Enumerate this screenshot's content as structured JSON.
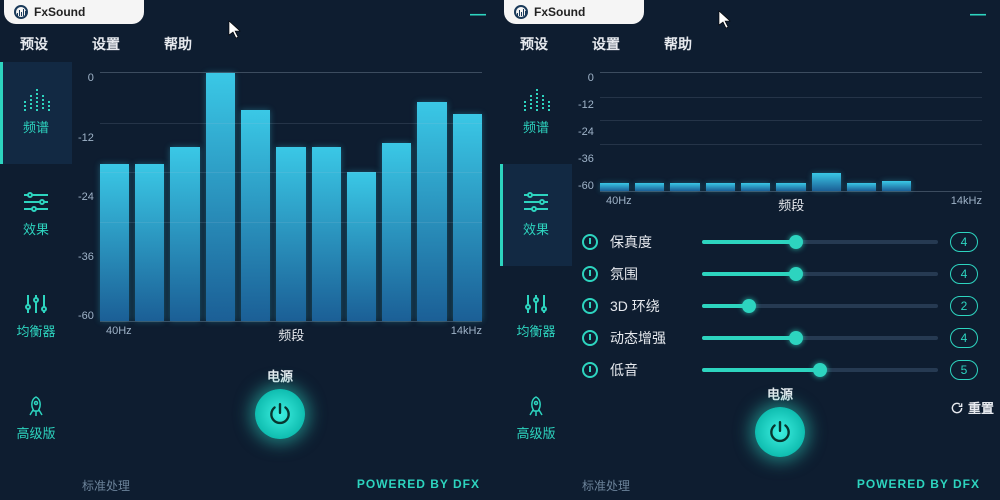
{
  "brand": "FxSound",
  "menu": {
    "presets": "预设",
    "settings": "设置",
    "help": "帮助"
  },
  "sidebar": {
    "spectrum": "频谱",
    "effects": "效果",
    "equalizer": "均衡器",
    "pro": "高级版"
  },
  "chart_data": [
    {
      "type": "bar",
      "title": "",
      "xlabel": "频段",
      "ylabel": "",
      "ylim": [
        -60,
        0
      ],
      "yticks": [
        0,
        -12,
        -24,
        -36,
        -60
      ],
      "xmin": "40Hz",
      "xmax": "14kHz",
      "values": [
        -22,
        -22,
        -18,
        0,
        -9,
        -18,
        -18,
        -24,
        -17,
        -7,
        -10
      ]
    },
    {
      "type": "bar",
      "title": "",
      "xlabel": "频段",
      "ylabel": "",
      "ylim": [
        -60,
        0
      ],
      "yticks": [
        0,
        -12,
        -24,
        -36,
        -60
      ],
      "xmin": "40Hz",
      "xmax": "14kHz",
      "values": [
        -56,
        -56,
        -56,
        -56,
        -56,
        -56,
        -51,
        -56,
        -55,
        -60,
        -60
      ]
    }
  ],
  "power_label": "电源",
  "effects": [
    {
      "label": "保真度",
      "value": 4,
      "max": 10
    },
    {
      "label": "氛围",
      "value": 4,
      "max": 10
    },
    {
      "label": "3D 环绕",
      "value": 2,
      "max": 10
    },
    {
      "label": "动态增强",
      "value": 4,
      "max": 10
    },
    {
      "label": "低音",
      "value": 5,
      "max": 10
    }
  ],
  "reset_label": "重置",
  "footer": {
    "status": "标准处理",
    "brand": "POWERED BY DFX"
  }
}
